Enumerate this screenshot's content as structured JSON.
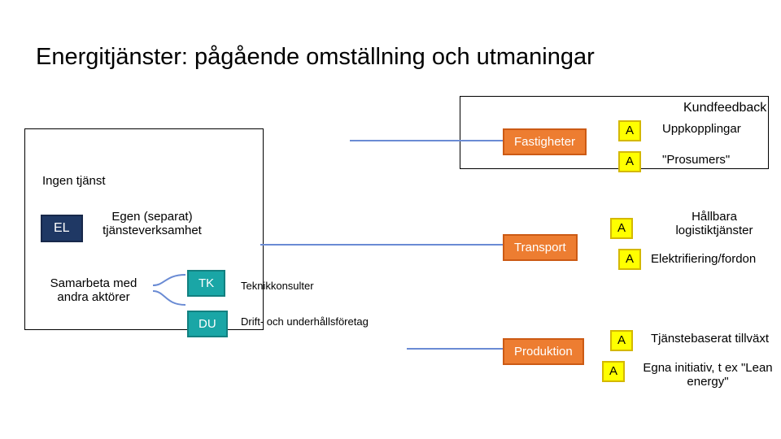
{
  "title": "Energitjänster: pågående omställning och utmaningar",
  "left": {
    "no_service": "Ingen tjänst",
    "el": "EL",
    "separate": "Egen (separat) tjänsteverksamhet",
    "collab": "Samarbeta med andra aktörer",
    "tk": "TK",
    "tk_label": "Teknikkonsulter",
    "du": "DU",
    "du_label": "Drift- och underhållsföretag"
  },
  "right": {
    "kundfeedback": "Kundfeedback",
    "fastigheter": "Fastigheter",
    "transport": "Transport",
    "produktion": "Produktion",
    "a": "A",
    "uppkopplingar": "Uppkopplingar",
    "prosumers": "\"Prosumers\"",
    "hallbara": "Hållbara logistiktjänster",
    "elektrifiering": "Elektrifiering/fordon",
    "tjanstebaserat": "Tjänstebaserat tillväxt",
    "egna": "Egna initiativ, t ex \"Lean energy\""
  }
}
